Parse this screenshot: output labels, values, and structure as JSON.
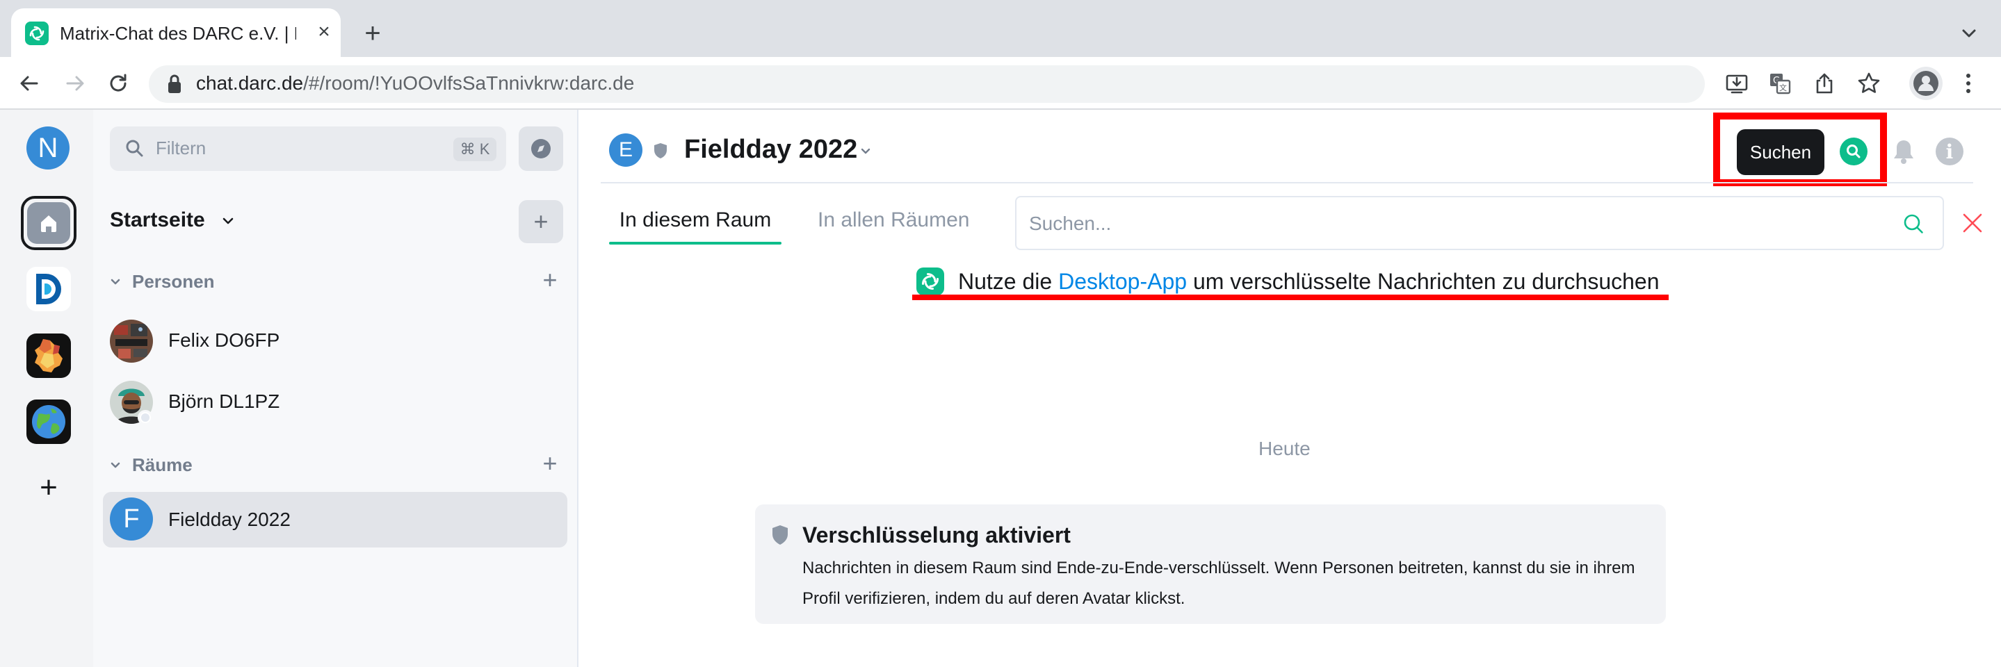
{
  "browser": {
    "tab_title": "Matrix-Chat des DARC e.V. | Ele",
    "url_host": "chat.darc.de",
    "url_rest": "/#/room/!YuOOvlfsSaTnnivkrw:darc.de"
  },
  "spaces": {
    "user_initial": "N",
    "add_label": "+"
  },
  "roomlist": {
    "filter_placeholder": "Filtern",
    "filter_shortcut": "⌘ K",
    "home_title": "Startseite",
    "add_label": "+",
    "people_section": "Personen",
    "rooms_section": "Räume",
    "people": [
      {
        "name": "Felix DO6FP"
      },
      {
        "name": "Björn DL1PZ"
      }
    ],
    "rooms": [
      {
        "name": "Fieldday 2022",
        "initial": "F"
      }
    ]
  },
  "room": {
    "initial": "E",
    "title": "Fieldday 2022",
    "tooltip": "Suchen",
    "tab_this_room": "In diesem Raum",
    "tab_all_rooms": "In allen Räumen",
    "search_placeholder": "Suchen...",
    "notice_pre": "Nutze die ",
    "notice_link": "Desktop-App",
    "notice_post": " um verschlüsselte Nachrichten zu durchsuchen",
    "date_separator": "Heute",
    "e2e_title": "Verschlüsselung aktiviert",
    "e2e_body": "Nachrichten in diesem Raum sind Ende-zu-Ende-verschlüsselt. Wenn Personen beitreten, kannst du sie in ihrem Profil verifizieren, indem du auf deren Avatar klickst."
  },
  "colors": {
    "accent": "#0dbd8b",
    "link": "#0086e6",
    "annotation": "#ff0000",
    "avatar_blue": "#368bd6"
  }
}
